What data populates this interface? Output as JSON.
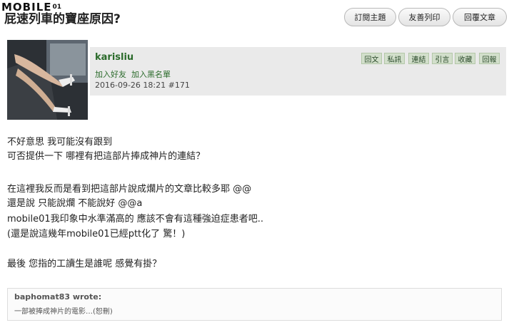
{
  "logo": {
    "brand": "MOBILE",
    "suffix": "01"
  },
  "title": "屁速列車的寶座原因?",
  "top_buttons": [
    {
      "label": "訂閱主題"
    },
    {
      "label": "友善列印"
    },
    {
      "label": "回覆文章"
    }
  ],
  "user": {
    "name": "karisliu",
    "add_friend": "加入好友",
    "add_blacklist": "加入黑名單",
    "date": "2016-09-26 18:21",
    "post_number": "#171"
  },
  "actions": [
    "回文",
    "私訊",
    "連結",
    "引言",
    "收藏",
    "回報"
  ],
  "post_lines": [
    "不好意思 我可能沒有跟到",
    "可否提供一下 哪裡有把這部片捧成神片的連結？",
    "",
    "在這裡我反而是看到把這部片說成爛片的文章比較多耶 @@",
    "還是說 只能說爛 不能說好 @@a",
    "mobile01我印象中水準滿高的 應該不會有這種強迫症患者吧..",
    "(還是說這幾年mobile01已經ptt化了 驚！)",
    "",
    "最後 您指的工讀生是誰呢 感覺有掛？"
  ],
  "quote": {
    "author": "baphomat83 wrote:",
    "text": "一部被捧成神片的電影…(恕刪)"
  }
}
